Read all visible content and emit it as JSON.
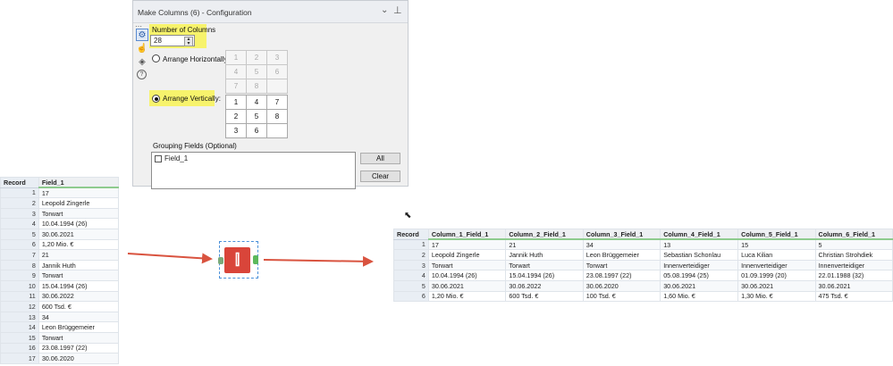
{
  "panel": {
    "title": "Make Columns (6) - Configuration",
    "icons": [
      "settings-icon",
      "cursor-icon",
      "tag-icon",
      "help-icon"
    ],
    "number_of_columns_label": "Number of Columns",
    "number_of_columns_value": "28",
    "arrange_horizontally_label": "Arrange Horizontally:",
    "arrange_vertically_label": "Arrange Vertically:",
    "horizontal_grid": [
      "1",
      "2",
      "3",
      "4",
      "5",
      "6",
      "7",
      "8",
      ""
    ],
    "vertical_grid": [
      "1",
      "4",
      "7",
      "2",
      "5",
      "8",
      "3",
      "6",
      ""
    ],
    "grouping_fields_label": "Grouping Fields (Optional)",
    "grouping_field_item": "Field_1",
    "all_button": "All",
    "clear_button": "Clear",
    "highlight_color": "#f7f36c"
  },
  "input_table": {
    "headers": [
      "Record",
      "Field_1"
    ],
    "rows": [
      [
        "1",
        "17"
      ],
      [
        "2",
        "Leopold Zingerle"
      ],
      [
        "3",
        "Torwart"
      ],
      [
        "4",
        "10.04.1994 (26)"
      ],
      [
        "5",
        "30.06.2021"
      ],
      [
        "6",
        "1,20 Mio. €"
      ],
      [
        "7",
        "21"
      ],
      [
        "8",
        "Jannik Huth"
      ],
      [
        "9",
        "Torwart"
      ],
      [
        "10",
        "15.04.1994 (26)"
      ],
      [
        "11",
        "30.06.2022"
      ],
      [
        "12",
        "600 Tsd. €"
      ],
      [
        "13",
        "34"
      ],
      [
        "14",
        "Leon Brüggemeier"
      ],
      [
        "15",
        "Torwart"
      ],
      [
        "16",
        "23.08.1997 (22)"
      ],
      [
        "17",
        "30.06.2020"
      ]
    ]
  },
  "output_table": {
    "headers": [
      "Record",
      "Column_1_Field_1",
      "Column_2_Field_1",
      "Column_3_Field_1",
      "Column_4_Field_1",
      "Column_5_Field_1",
      "Column_6_Field_1"
    ],
    "rows": [
      [
        "1",
        "17",
        "21",
        "34",
        "13",
        "15",
        "5"
      ],
      [
        "2",
        "Leopold Zingerle",
        "Jannik Huth",
        "Leon Brüggemeier",
        "Sebastian Schonlau",
        "Luca Kilian",
        "Christian Strohdiek"
      ],
      [
        "3",
        "Torwart",
        "Torwart",
        "Torwart",
        "Innenverteidiger",
        "Innenverteidiger",
        "Innenverteidiger"
      ],
      [
        "4",
        "10.04.1994 (26)",
        "15.04.1994 (26)",
        "23.08.1997 (22)",
        "05.08.1994 (25)",
        "01.09.1999 (20)",
        "22.01.1988 (32)"
      ],
      [
        "5",
        "30.06.2021",
        "30.06.2022",
        "30.06.2020",
        "30.06.2021",
        "30.06.2021",
        "30.06.2021"
      ],
      [
        "6",
        "1,20 Mio. €",
        "600 Tsd. €",
        "100 Tsd. €",
        "1,60 Mio. €",
        "1,30 Mio. €",
        "475 Tsd. €"
      ]
    ]
  },
  "tool": {
    "icon": "make-columns-icon",
    "color": "#d9453a"
  },
  "arrow_color": "#d9533f"
}
